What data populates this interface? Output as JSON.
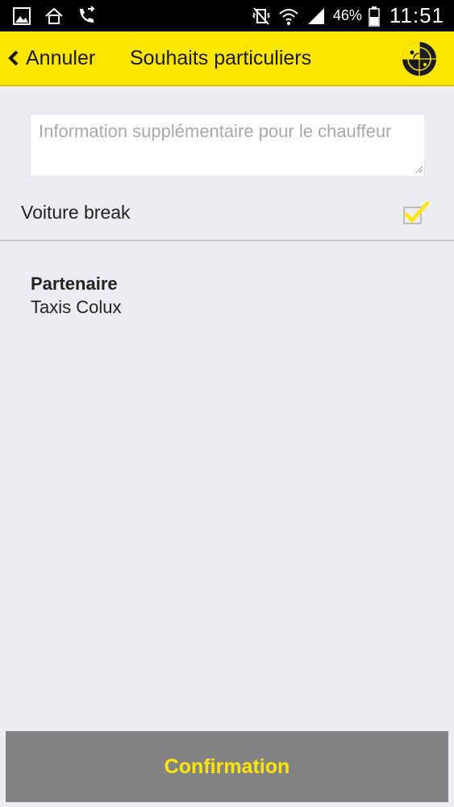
{
  "status_bar": {
    "battery_percent": "46%",
    "time": "11:51"
  },
  "header": {
    "back_label": "Annuler",
    "title": "Souhaits particuliers",
    "accent_color": "#ffe600"
  },
  "form": {
    "info_placeholder": "Information supplémentaire pour le chauffeur",
    "info_value": "",
    "break_label": "Voiture break",
    "break_checked": true
  },
  "partner": {
    "title": "Partenaire",
    "value": "Taxis Colux"
  },
  "footer": {
    "confirm_label": "Confirmation"
  }
}
